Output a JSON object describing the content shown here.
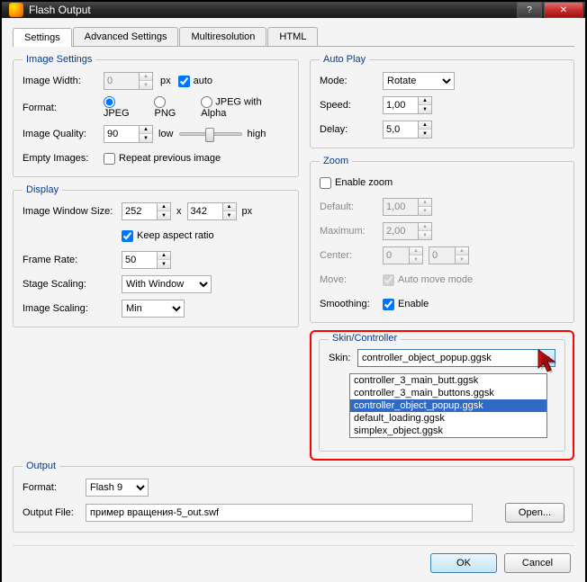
{
  "window": {
    "title": "Flash Output"
  },
  "tabs": [
    "Settings",
    "Advanced Settings",
    "Multiresolution",
    "HTML"
  ],
  "imageSettings": {
    "legend": "Image Settings",
    "widthLabel": "Image Width:",
    "widthValue": "0",
    "pxLabel": "px",
    "autoLabel": "auto",
    "formatLabel": "Format:",
    "fmtJpeg": "JPEG",
    "fmtPng": "PNG",
    "fmtJpegAlpha": "JPEG with Alpha",
    "qualityLabel": "Image Quality:",
    "qualityValue": "90",
    "lowLabel": "low",
    "highLabel": "high",
    "emptyLabel": "Empty Images:",
    "repeatLabel": "Repeat previous image"
  },
  "display": {
    "legend": "Display",
    "winSizeLabel": "Image Window Size:",
    "w": "252",
    "h": "342",
    "xLabel": "x",
    "pxLabel": "px",
    "keepAspect": "Keep aspect ratio",
    "frameRateLabel": "Frame Rate:",
    "frameRate": "50",
    "stageScalingLabel": "Stage Scaling:",
    "stageScaling": "With Window",
    "imageScalingLabel": "Image Scaling:",
    "imageScaling": "Min"
  },
  "autoPlay": {
    "legend": "Auto Play",
    "modeLabel": "Mode:",
    "mode": "Rotate",
    "speedLabel": "Speed:",
    "speed": "1,00",
    "delayLabel": "Delay:",
    "delay": "5,0"
  },
  "zoom": {
    "legend": "Zoom",
    "enableLabel": "Enable zoom",
    "defaultLabel": "Default:",
    "default": "1,00",
    "maxLabel": "Maximum:",
    "max": "2,00",
    "centerLabel": "Center:",
    "cx": "0",
    "cy": "0",
    "moveLabel": "Move:",
    "autoMove": "Auto move mode",
    "smoothLabel": "Smoothing:",
    "smoothEnable": "Enable"
  },
  "skin": {
    "legend": "Skin/Controller",
    "label": "Skin:",
    "value": "controller_object_popup.ggsk",
    "options": [
      "controller_3_main_butt.ggsk",
      "controller_3_main_buttons.ggsk",
      "controller_object_popup.ggsk",
      "default_loading.ggsk",
      "simplex_object.ggsk"
    ]
  },
  "output": {
    "legend": "Output",
    "formatLabel": "Format:",
    "format": "Flash 9",
    "fileLabel": "Output File:",
    "file": "пример вращения-5_out.swf",
    "openBtn": "Open..."
  },
  "buttons": {
    "ok": "OK",
    "cancel": "Cancel"
  }
}
